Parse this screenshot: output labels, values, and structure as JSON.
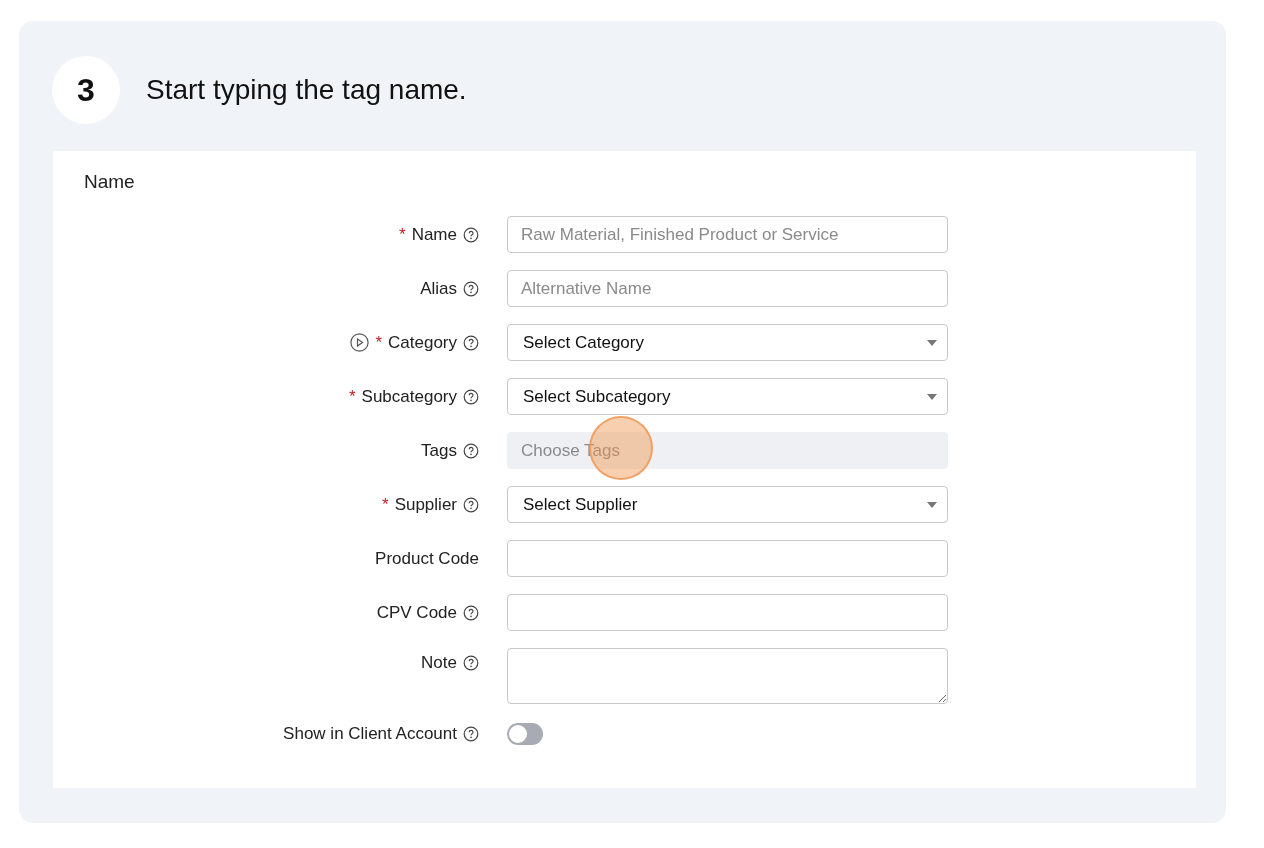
{
  "step": {
    "number": "3",
    "title": "Start typing the tag name."
  },
  "section": {
    "title": "Name"
  },
  "fields": [
    {
      "kind": "text",
      "asterisk": "*",
      "label": "Name",
      "video": false,
      "help": true,
      "highlighted": false,
      "placeholder": "Raw Material, Finished Product or Service"
    },
    {
      "kind": "text",
      "label": "Alias",
      "video": false,
      "help": true,
      "highlighted": false,
      "placeholder": "Alternative Name"
    },
    {
      "kind": "select",
      "asterisk": "*",
      "label": "Category",
      "video": true,
      "help": true,
      "highlighted": false,
      "value": "Select Category"
    },
    {
      "kind": "select",
      "asterisk": "*",
      "label": "Subcategory",
      "video": false,
      "help": true,
      "highlighted": false,
      "value": "Select Subcategory"
    },
    {
      "kind": "tags",
      "label": "Tags",
      "video": false,
      "help": true,
      "highlighted": true,
      "placeholder": "Choose Tags"
    },
    {
      "kind": "select",
      "asterisk": "*",
      "label": "Supplier",
      "video": false,
      "help": true,
      "highlighted": false,
      "value": "Select Supplier"
    },
    {
      "kind": "text",
      "label": "Product Code",
      "video": false,
      "help": false,
      "highlighted": false
    },
    {
      "kind": "text",
      "label": "CPV Code",
      "video": false,
      "help": true,
      "highlighted": false
    },
    {
      "kind": "textarea",
      "label": "Note",
      "video": false,
      "help": true,
      "highlighted": false
    },
    {
      "kind": "toggle",
      "label": "Show in Client Account",
      "video": false,
      "help": true,
      "highlighted": false,
      "on": false
    }
  ]
}
